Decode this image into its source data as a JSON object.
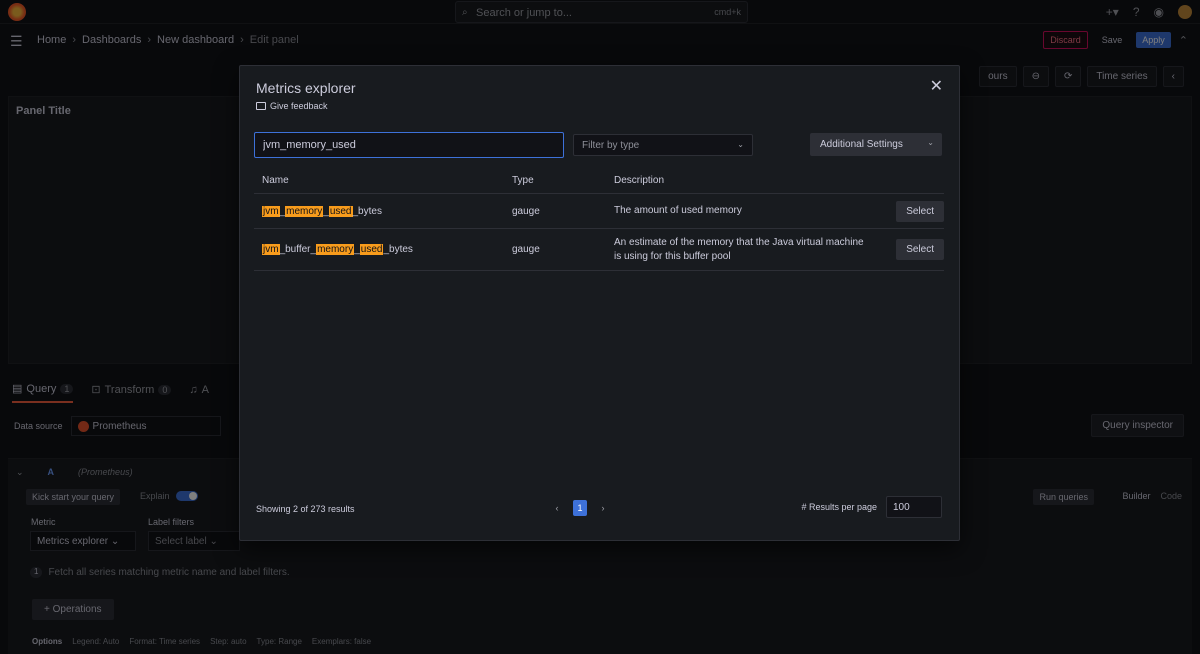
{
  "topbar": {
    "search_placeholder": "Search or jump to...",
    "search_shortcut": "cmd+k"
  },
  "breadcrumb": {
    "items": [
      "Home",
      "Dashboards",
      "New dashboard"
    ],
    "current": "Edit panel"
  },
  "header_buttons": {
    "discard": "Discard",
    "save": "Save",
    "apply": "Apply"
  },
  "panel": {
    "title": "Panel Title",
    "time_range": "ours",
    "viz": "Time series"
  },
  "tabs": [
    {
      "label": "Query",
      "count": "1"
    },
    {
      "label": "Transform",
      "count": "0"
    },
    {
      "label": "A"
    }
  ],
  "datasource": {
    "label": "Data source",
    "value": "Prometheus",
    "query_inspector": "Query inspector"
  },
  "query_editor": {
    "ref": "A",
    "source": "(Prometheus)",
    "kick_start": "Kick start your query",
    "explain": "Explain",
    "run_queries": "Run queries",
    "builder": "Builder",
    "code": "Code",
    "metric_label": "Metric",
    "label_filters": "Label filters",
    "metric_value": "Metrics explorer",
    "label_placeholder": "Select label",
    "hint_num": "1",
    "hint_text": "Fetch all series matching metric name and label filters.",
    "operations": "+ Operations",
    "options": {
      "label": "Options",
      "legend": "Legend: Auto",
      "format": "Format: Time series",
      "step": "Step: auto",
      "type": "Type: Range",
      "exemplars": "Exemplars: false"
    }
  },
  "modal": {
    "title": "Metrics explorer",
    "feedback": "Give feedback",
    "search_value": "jvm_memory_used",
    "filter_placeholder": "Filter by type",
    "additional_settings": "Additional Settings",
    "columns": {
      "name": "Name",
      "type": "Type",
      "description": "Description"
    },
    "rows": [
      {
        "name_parts": [
          {
            "t": "jvm",
            "h": true
          },
          {
            "t": "_",
            "h": false
          },
          {
            "t": "memory",
            "h": true
          },
          {
            "t": "_",
            "h": false
          },
          {
            "t": "used",
            "h": true
          },
          {
            "t": "_bytes",
            "h": false
          }
        ],
        "type": "gauge",
        "description": "The amount of used memory",
        "action": "Select"
      },
      {
        "name_parts": [
          {
            "t": "jvm",
            "h": true
          },
          {
            "t": "_buffer_",
            "h": false
          },
          {
            "t": "memory",
            "h": true
          },
          {
            "t": "_",
            "h": false
          },
          {
            "t": "used",
            "h": true
          },
          {
            "t": "_bytes",
            "h": false
          }
        ],
        "type": "gauge",
        "description": "An estimate of the memory that the Java virtual machine is using for this buffer pool",
        "action": "Select"
      }
    ],
    "results_summary": "Showing 2 of 273 results",
    "page": "1",
    "results_per_page_label": "# Results per page",
    "results_per_page": "100"
  }
}
